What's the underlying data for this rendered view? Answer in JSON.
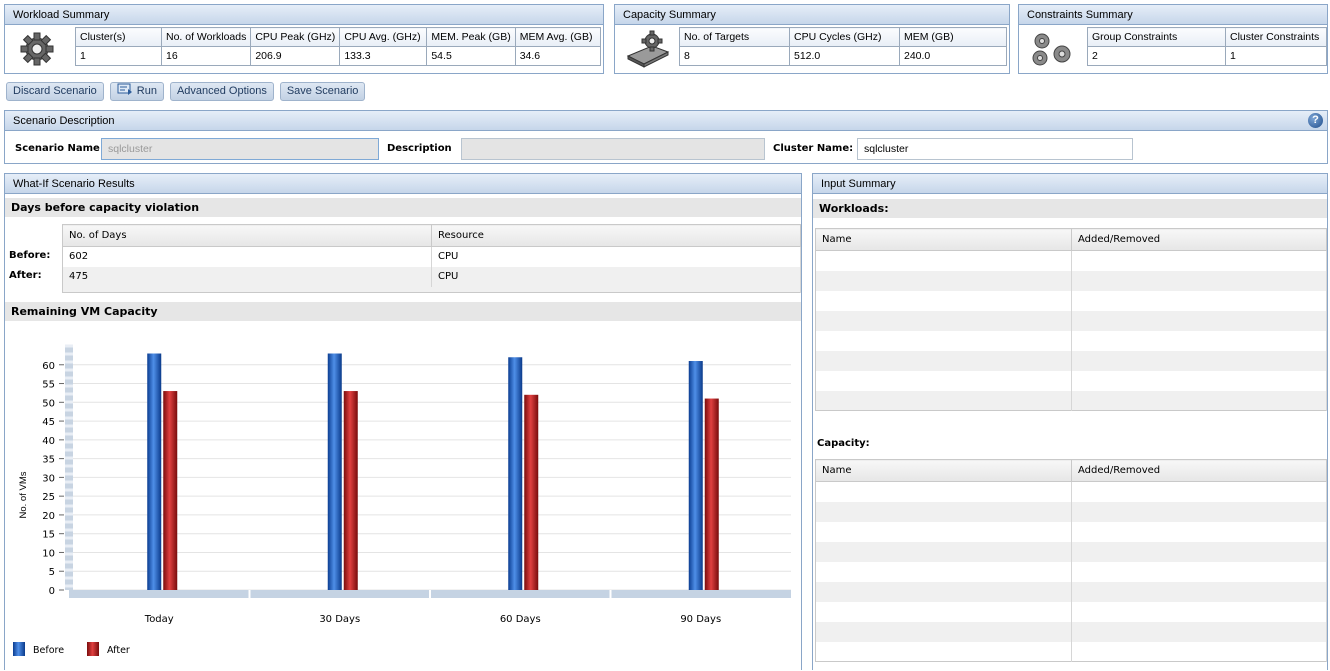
{
  "workload_summary": {
    "title": "Workload Summary",
    "icon": "gear-icon",
    "headers": [
      "Cluster(s)",
      "No. of Workloads",
      "CPU Peak (GHz)",
      "CPU Avg. (GHz)",
      "MEM. Peak (GB)",
      "MEM Avg. (GB)"
    ],
    "values": [
      "1",
      "16",
      "206.9",
      "133.3",
      "54.5",
      "34.6"
    ]
  },
  "capacity_summary": {
    "title": "Capacity Summary",
    "icon": "server-gear-icon",
    "headers": [
      "No. of Targets",
      "CPU Cycles (GHz)",
      "MEM (GB)"
    ],
    "values": [
      "8",
      "512.0",
      "240.0"
    ]
  },
  "constraints_summary": {
    "title": "Constraints Summary",
    "icon": "gears-icon",
    "headers": [
      "Group Constraints",
      "Cluster Constraints"
    ],
    "values": [
      "2",
      "1"
    ]
  },
  "toolbar": {
    "discard": "Discard Scenario",
    "run": "Run",
    "advanced": "Advanced Options",
    "save": "Save Scenario"
  },
  "scenario": {
    "title": "Scenario Description",
    "name_label": "Scenario Name",
    "name_value": "sqlcluster",
    "description_label": "Description",
    "description_value": "",
    "cluster_label": "Cluster Name:",
    "cluster_value": "sqlcluster",
    "help": "?"
  },
  "results": {
    "title": "What-If Scenario Results",
    "days_title": "Days before capacity violation",
    "headers": [
      "No. of Days",
      "Resource"
    ],
    "rows": [
      {
        "label": "Before:",
        "days": "602",
        "resource": "CPU"
      },
      {
        "label": "After:",
        "days": "475",
        "resource": "CPU"
      }
    ],
    "vm_title": "Remaining VM Capacity"
  },
  "chart_data": {
    "type": "bar",
    "categories": [
      "Today",
      "30 Days",
      "60 Days",
      "90 Days"
    ],
    "series": [
      {
        "name": "Before",
        "values": [
          63,
          63,
          62,
          61
        ],
        "color": "#1f5fc4"
      },
      {
        "name": "After",
        "values": [
          53,
          53,
          52,
          51
        ],
        "color": "#c41e1e"
      }
    ],
    "ylabel": "No. of VMs",
    "yticks": [
      0,
      5,
      10,
      15,
      20,
      25,
      30,
      35,
      40,
      45,
      50,
      55,
      60
    ],
    "ylim": [
      0,
      65
    ],
    "legend": "bottom-left"
  },
  "input_summary": {
    "title": "Input Summary",
    "workloads_title": "Workloads:",
    "capacity_title": "Capacity:",
    "headers": [
      "Name",
      "Added/Removed"
    ]
  }
}
